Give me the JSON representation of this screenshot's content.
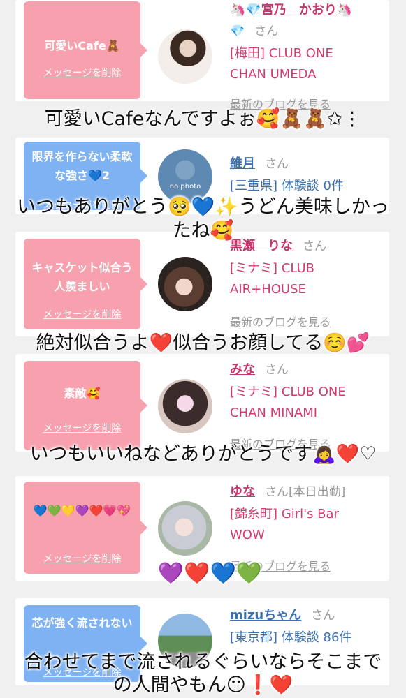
{
  "cards": [
    {
      "bubble_text": "可愛いCafe🧸",
      "bubble_delete": "メッセージを削除",
      "name_prefix": "🦄💎",
      "name": "宮乃　かおり",
      "name_suffix": "🦄",
      "badge": "💎",
      "san": "さん",
      "store_line1": "[梅田] CLUB ONE",
      "store_line2": "CHAN UMEDA",
      "blog_link": "最新のブログを見る"
    },
    {
      "bubble_text": "限界を作らない柔軟な強さ💙2",
      "bubble_delete": "メッセージを削除",
      "name": "維月",
      "san": "さん",
      "avatar_caption": "no photo",
      "store_line1": "[三重県] 体験談 0件"
    },
    {
      "bubble_text": "キャスケット似合う人羨ましい",
      "bubble_delete": "メッセージを削除",
      "name": "黒瀬　りな",
      "san": "さん",
      "store_line1": "[ミナミ] CLUB",
      "store_line2": "AIR+HOUSE",
      "blog_link": "最新のブログを見る"
    },
    {
      "bubble_text": "素敵🥰",
      "bubble_delete": "メッセージを削除",
      "name": "みな",
      "san": "さん",
      "store_line1": "[ミナミ] CLUB ONE",
      "store_line2": "CHAN MINAMI",
      "blog_link": "最新のブログを見る"
    },
    {
      "bubble_text": "💙💚💛💜❤️💗💖",
      "bubble_delete": "メッセージを削除",
      "name": "ゆな",
      "san": "さん[本日出勤]",
      "store_line1": "[錦糸町] Girl's Bar",
      "store_line2": "WOW",
      "blog_link": "最新のブログを見る"
    },
    {
      "bubble_text": "芯が強く流されない",
      "bubble_delete": "メッセージを削除",
      "name": "mizuちゃん",
      "san": "さん",
      "store_line1": "[東京都] 体験談 86件"
    }
  ],
  "overlays": {
    "line1": "可愛いCafeなんですよぉ🥰🧸🧸✩⋮",
    "line2a": "いつもありがとう🥺💙✨うどん美味しかっ",
    "line2b": "たね🥰",
    "line3": "絶対似合うよ❤️似合うお顔してる☺️💕",
    "line4": "いつもいいねなどありがとうです🙇‍♀️❤️♡",
    "line5": "💜❤️💙💚",
    "line6a": "合わせてまで流されるぐらいならそこまで",
    "line6b": "の人間やもん😶❗❤️"
  }
}
